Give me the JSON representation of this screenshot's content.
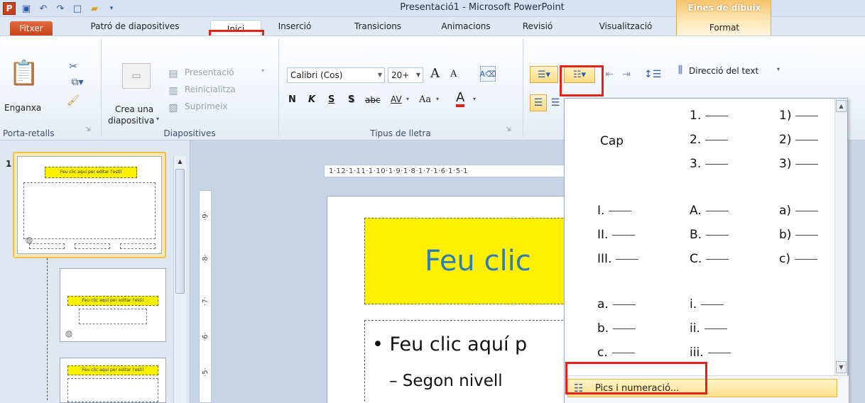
{
  "app": {
    "window_title": "Presentació1 - Microsoft PowerPoint",
    "contextual_group": "Eines de dibuix"
  },
  "tabs": [
    {
      "label": "Fitxer"
    },
    {
      "label": "Patró de diapositives"
    },
    {
      "label": "Inici"
    },
    {
      "label": "Inserció"
    },
    {
      "label": "Transicions"
    },
    {
      "label": "Animacions"
    },
    {
      "label": "Revisió"
    },
    {
      "label": "Visualització"
    },
    {
      "label": "Format"
    }
  ],
  "ribbon": {
    "clipboard": {
      "paste": "Enganxa",
      "group": "Porta-retalls"
    },
    "slides": {
      "new_slide_line1": "Crea una",
      "new_slide_line2": "diapositiva",
      "layout": "Presentació",
      "reset": "Reinicialitza",
      "delete": "Suprimeix",
      "group": "Diapositives"
    },
    "font": {
      "font_name": "Calibri (Cos)",
      "font_size": "20+",
      "bold": "N",
      "italic": "K",
      "underline": "S",
      "shadow": "S",
      "strike": "abc",
      "spacing": "AV",
      "case": "Aa",
      "color": "A",
      "grow": "A",
      "shrink": "A",
      "group": "Tipus de lletra"
    },
    "paragraph": {
      "text_direction": "Direcció del text"
    }
  },
  "thumbnails": [
    {
      "num": "1",
      "title": "Feu clic aquí per editar l'estil"
    },
    {
      "num": "",
      "title": "Feu clic aquí per editar l'estil"
    },
    {
      "num": "",
      "title": "Feu clic aquí per editar l'estil"
    }
  ],
  "ruler": {
    "h": "1·12·1·11·1·10·1·9·1·8·1·7·1·6·1·5·1"
  },
  "slide": {
    "title": "Feu clic",
    "bullet1": "• Feu clic aquí p",
    "bullet2": "– Segon nivell"
  },
  "numbering": {
    "none": "Cap",
    "col_arabic_dot": [
      "1.",
      "2.",
      "3."
    ],
    "col_arabic_paren": [
      "1)",
      "2)",
      "3)"
    ],
    "col_roman_upper": [
      "I.",
      "II.",
      "III."
    ],
    "col_alpha_upper": [
      "A.",
      "B.",
      "C."
    ],
    "col_alpha_lower_paren": [
      "a)",
      "b)",
      "c)"
    ],
    "col_alpha_lower": [
      "a.",
      "b.",
      "c."
    ],
    "col_roman_lower": [
      "i.",
      "ii.",
      "iii."
    ],
    "menu_item": "Pics i numeració..."
  }
}
